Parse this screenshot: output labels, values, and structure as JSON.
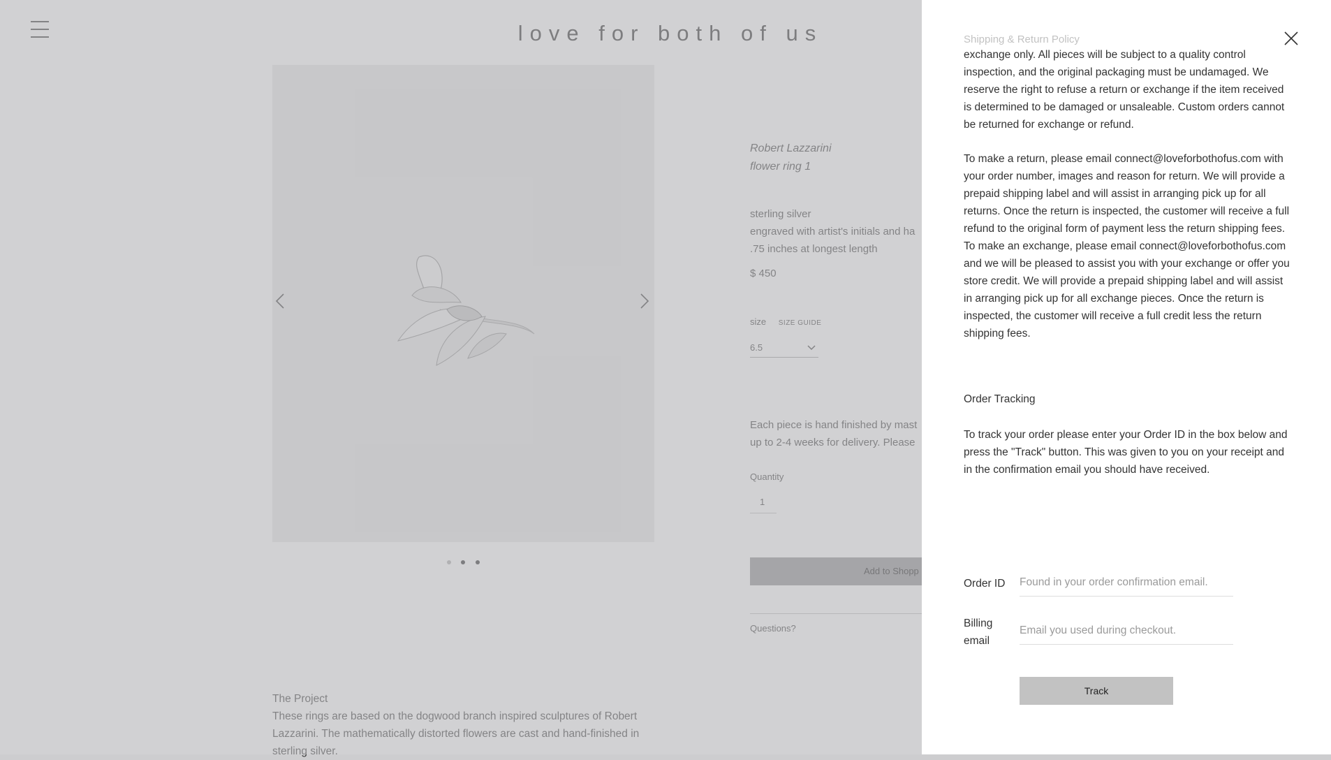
{
  "header": {
    "logo": "love for both of us",
    "menu_icon": "hamburger-menu-icon"
  },
  "product": {
    "artist": "Robert Lazzarini",
    "title": "flower ring 1",
    "material": "sterling silver",
    "engraving": "engraved with artist's initials and ha",
    "dimension": ".75 inches at longest length",
    "price": "$ 450",
    "size_label": "size",
    "size_guide": "SIZE GUIDE",
    "size_value": "6.5",
    "finish_note_1": "Each piece is hand finished by mast",
    "finish_note_2": "up to 2-4 weeks for delivery. Please",
    "quantity_label": "Quantity",
    "quantity_value": "1",
    "add_button": "Add to Shopp",
    "questions": "Questions?",
    "gallery": {
      "dots": 3,
      "active_index": 1
    }
  },
  "project": {
    "heading": "The Project",
    "text": "These rings are based on the dogwood branch inspired sculptures of Robert Lazzarini. The mathematically distorted flowers are cast and hand-finished in sterling silver."
  },
  "drawer": {
    "policy_heading": "Shipping & Return Policy",
    "policy_p1": "exchange only. All pieces will be subject to a quality control inspection, and the original packaging must be undamaged. We reserve the right to refuse a return or exchange if the item received is determined to be damaged or unsaleable. Custom orders cannot be returned for exchange or refund.",
    "policy_p2": "To make a return, please email connect@loveforbothofus.com with your order number, images and reason for return. We will provide a prepaid shipping label and will assist in arranging pick up for all returns. Once the return is inspected, the customer will receive a full refund to the original form of payment less the return shipping fees. To make an exchange, please email connect@loveforbothofus.com and we will be pleased to assist you with your exchange or offer you store credit. We will provide a prepaid shipping label and will assist in arranging pick up for all exchange pieces. Once the return is inspected, the customer will receive a full credit less the return shipping fees.",
    "tracking_heading": "Order Tracking",
    "tracking_text": "To track your order please enter your Order ID in the box below and press the \"Track\" button. This was given to you on your receipt and in the confirmation email you should have received.",
    "order_id_label": "Order ID",
    "order_id_placeholder": "Found in your order confirmation email.",
    "billing_label_1": "Billing",
    "billing_label_2": "email",
    "billing_placeholder": "Email you used during checkout.",
    "track_button": "Track"
  }
}
